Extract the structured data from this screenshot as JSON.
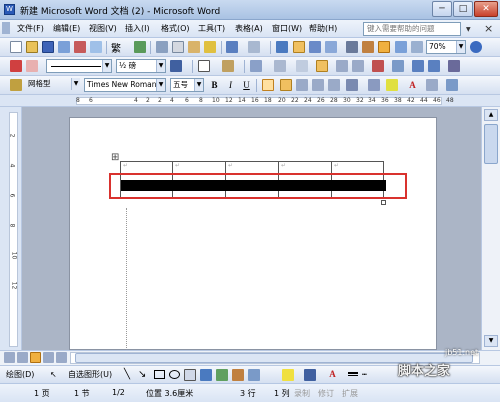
{
  "window": {
    "title": "新建 Microsoft Word 文档 (2) - Microsoft Word",
    "minimize": "─",
    "maximize": "□",
    "close": "✕"
  },
  "menu": {
    "items": [
      "文件(F)",
      "编辑(E)",
      "视图(V)",
      "插入(I)",
      "格式(O)",
      "工具(T)",
      "表格(A)",
      "窗口(W)",
      "帮助(H)"
    ],
    "help_placeholder": "键入需要帮助的问题",
    "close_doc": "×"
  },
  "toolbar1": {
    "trad_simplified": "繁",
    "zoom": "70%"
  },
  "toolbar2": {
    "line_weight": "½ 磅"
  },
  "format_toolbar": {
    "style": "网格型",
    "font": "Times New Roman",
    "size": "五号",
    "bold": "B",
    "italic": "I",
    "underline": "U",
    "font_color_letter": "A"
  },
  "ruler": {
    "ticks": [
      "8",
      "6",
      "4",
      "2",
      "2",
      "4",
      "6",
      "8",
      "10",
      "12",
      "14",
      "16",
      "18",
      "20",
      "22",
      "24",
      "26",
      "28",
      "30",
      "32",
      "34",
      "36",
      "38",
      "42",
      "44",
      "46",
      "48"
    ]
  },
  "vruler": {
    "ticks": [
      "2",
      "4",
      "6",
      "8",
      "10",
      "12"
    ]
  },
  "document": {
    "table_handle": "⊞",
    "cell_mark": "↵"
  },
  "drawbar": {
    "draw": "绘图(D)",
    "autoshapes": "自选图形(U)"
  },
  "status": {
    "page": "1 页",
    "section": "1 节",
    "pages": "1/2",
    "position": "位置 3.6厘米",
    "line": "3 行",
    "column": "1 列",
    "rec": "录制",
    "trk": "修订",
    "ext": "扩展"
  },
  "watermark": {
    "site": "jb51.net",
    "brand": "脚本之家"
  },
  "colors": {
    "highlight_box": "#d9322e",
    "toolbar_blue": "#d5e0f1"
  }
}
